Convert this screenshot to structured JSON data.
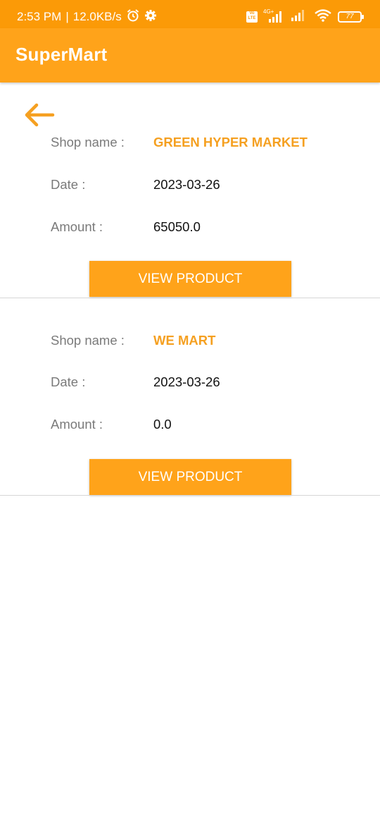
{
  "status_bar": {
    "time": "2:53 PM",
    "separator": "|",
    "speed": "12.0KB/s",
    "battery": "77",
    "volte": "Vo LTE",
    "network": "4G+"
  },
  "app_bar": {
    "title": "SuperMart"
  },
  "labels": {
    "shop_name": "Shop name :",
    "date": "Date :",
    "amount": "Amount :"
  },
  "orders": [
    {
      "shop_name": "GREEN HYPER MARKET",
      "date": "2023-03-26",
      "amount": "65050.0",
      "button": "VIEW PRODUCT"
    },
    {
      "shop_name": "WE MART",
      "date": "2023-03-26",
      "amount": "0.0",
      "button": "VIEW PRODUCT"
    }
  ],
  "colors": {
    "accent": "#FFA31A",
    "status_bar": "#FB9A07",
    "shop_text": "#F5A021"
  },
  "icons": [
    "alarm-icon",
    "settings-icon",
    "signal-icon",
    "wifi-icon",
    "battery-icon",
    "back-arrow-icon"
  ]
}
